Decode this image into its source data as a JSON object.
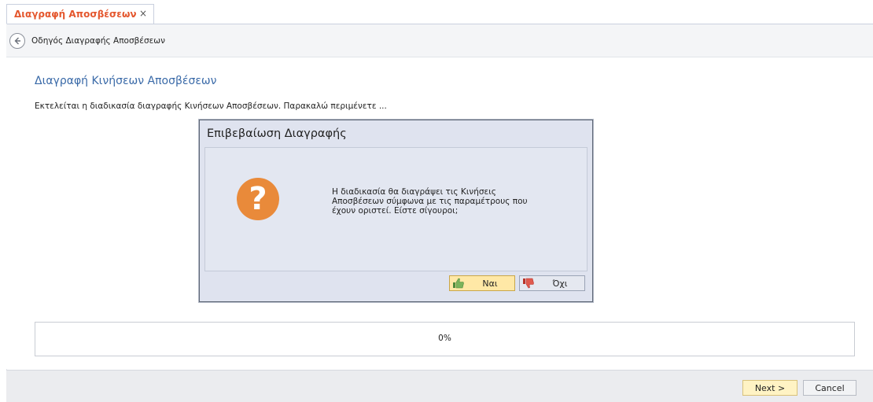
{
  "tab": {
    "label": "Διαγραφή Αποσβέσεων",
    "close": "×"
  },
  "breadcrumb": {
    "text": "Οδηγός Διαγραφής Αποσβέσεων"
  },
  "main": {
    "title": "Διαγραφή Κινήσεων Αποσβέσεων",
    "status": "Εκτελείται η διαδικασία διαγραφής Κινήσεων Αποσβέσεων. Παρακαλώ περιμένετε ..."
  },
  "progress": {
    "value": 0,
    "label": "0%"
  },
  "footer": {
    "next_label": "Next >",
    "cancel_label": "Cancel"
  },
  "dialog": {
    "title": "Επιβεβαίωση Διαγραφής",
    "message_lines": [
      "Η διαδικασία θα διαγράψει τις Κινήσεις",
      "Αποσβέσεων σύμφωνα με τις παραμέτρους που",
      "έχουν οριστεί. Είστε σίγουροι;"
    ],
    "icon": "question-icon",
    "yes_label": "Ναι",
    "no_label": "Όχι"
  },
  "colors": {
    "accent_tab": "#e4572e",
    "title_blue": "#3a6aa8",
    "question_orange": "#e98a3a",
    "yes_highlight": "#ffe8a6"
  }
}
